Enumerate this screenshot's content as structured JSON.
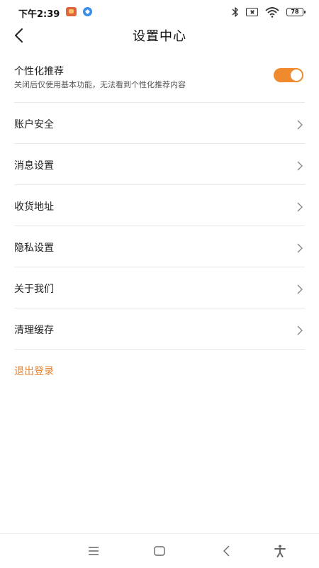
{
  "status_bar": {
    "time": "下午2:39",
    "battery_level": "78",
    "icons": [
      "app-icon",
      "notify-icon",
      "bluetooth-icon",
      "sim-icon",
      "wifi-icon",
      "battery-icon"
    ]
  },
  "header": {
    "title": "设置中心",
    "back_icon": "chevron-left-icon"
  },
  "personalized": {
    "title": "个性化推荐",
    "description": "关闭后仅使用基本功能，无法看到个性化推荐内容",
    "toggle_on": true,
    "accent_color": "#ef8a2f"
  },
  "menu": {
    "items": [
      {
        "label": "账户安全"
      },
      {
        "label": "消息设置"
      },
      {
        "label": "收货地址"
      },
      {
        "label": "隐私设置"
      },
      {
        "label": "关于我们"
      },
      {
        "label": "清理缓存"
      }
    ]
  },
  "logout": {
    "label": "退出登录",
    "color": "#e48634"
  },
  "nav_bar": {
    "icons": [
      "menu-icon",
      "home-icon",
      "back-icon",
      "accessibility-icon"
    ]
  }
}
